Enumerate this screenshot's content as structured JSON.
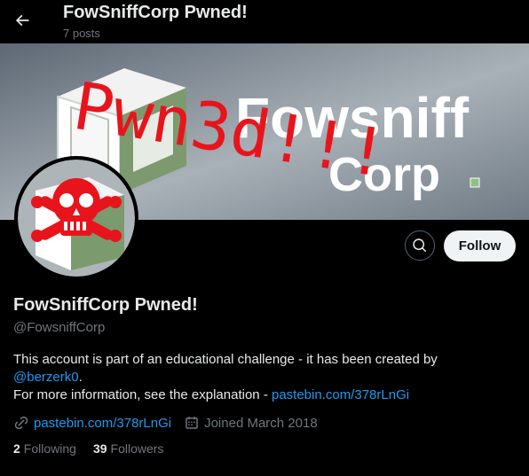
{
  "header": {
    "title": "FowSniffCorp Pwned!",
    "posts": "7 posts"
  },
  "banner": {
    "brand_line1": "Fowsniff",
    "brand_line2": "Corp",
    "graffiti": "Pwn3d!!!",
    "graffiti_color": "#e8141c"
  },
  "profile": {
    "name": "FowSniffCorp Pwned!",
    "handle": "@FowsniffCorp",
    "follow_label": "Follow",
    "bio": {
      "text1": "This account is part of an educational challenge - it has been created by",
      "mention": "@berzerk0",
      "after_mention": ".",
      "text2": "For more information, see the explanation - ",
      "link": "pastebin.com/378rLnGi"
    },
    "website": "pastebin.com/378rLnGi",
    "joined": "Joined March 2018",
    "following_count": "2",
    "following_label": "Following",
    "followers_count": "39",
    "followers_label": "Followers"
  },
  "colors": {
    "background": "#000000",
    "link": "#1d9bf0",
    "muted": "#71767b",
    "follow_bg": "#eff3f4",
    "skull_red": "#e8141c"
  },
  "icons": {
    "back": "back-arrow-icon",
    "search": "search-icon",
    "link": "link-icon",
    "calendar": "calendar-icon"
  }
}
